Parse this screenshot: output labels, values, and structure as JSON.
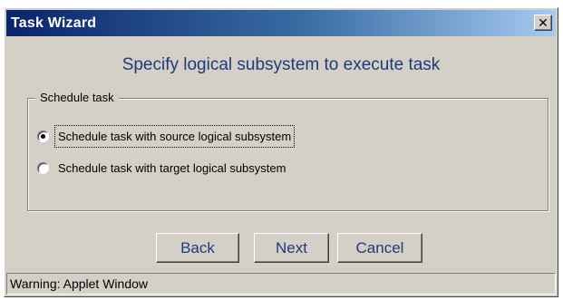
{
  "window": {
    "title": "Task Wizard",
    "close_glyph": "✕"
  },
  "heading": "Specify logical subsystem to execute task",
  "schedule_group": {
    "legend": "Schedule task",
    "options": [
      {
        "label": "Schedule task with source logical subsystem",
        "selected": true
      },
      {
        "label": "Schedule task with target logical subsystem",
        "selected": false
      }
    ]
  },
  "buttons": {
    "back": "Back",
    "next": "Next",
    "cancel": "Cancel"
  },
  "status": "Warning: Applet Window",
  "colors": {
    "title_bar_start": "#0a246a",
    "title_bar_end": "#a6caf0",
    "dialog_bg": "#d4d0c8",
    "heading_text": "#1f3a7a"
  }
}
